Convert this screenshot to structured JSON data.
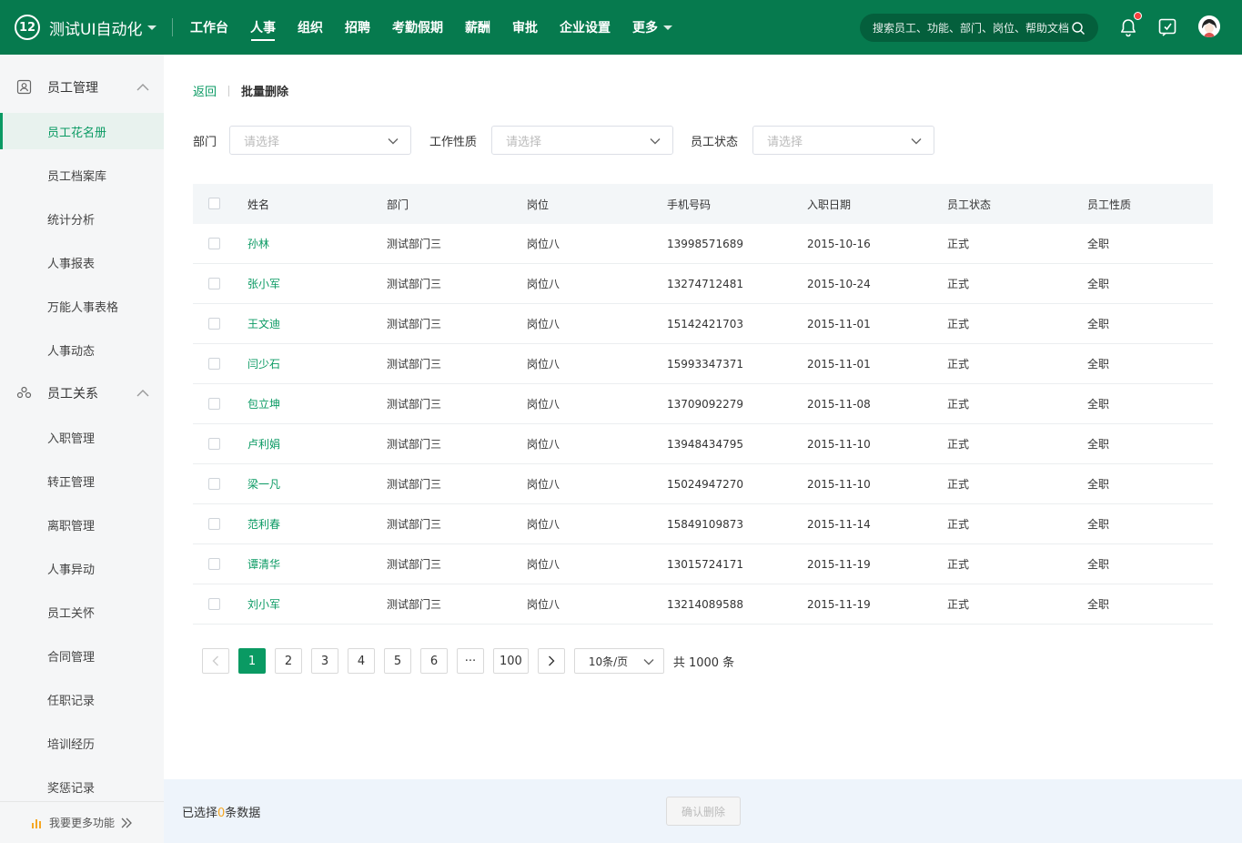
{
  "header": {
    "app_name": "测试UI自动化",
    "logo_text": "12",
    "nav": [
      "工作台",
      "人事",
      "组织",
      "招聘",
      "考勤假期",
      "薪酬",
      "审批",
      "企业设置",
      "更多"
    ],
    "active_nav": "人事",
    "search_placeholder": "搜索员工、功能、部门、岗位、帮助文档"
  },
  "sidebar": {
    "group1": "员工管理",
    "items1": [
      "员工花名册",
      "员工档案库",
      "统计分析",
      "人事报表",
      "万能人事表格",
      "人事动态"
    ],
    "active_item": "员工花名册",
    "group2": "员工关系",
    "items2": [
      "入职管理",
      "转正管理",
      "离职管理",
      "人事异动",
      "员工关怀",
      "合同管理",
      "任职记录",
      "培训经历",
      "奖惩记录"
    ],
    "more_features": "我要更多功能"
  },
  "breadcrumb": {
    "back": "返回",
    "current": "批量删除"
  },
  "filters": {
    "dept_label": "部门",
    "nature_label": "工作性质",
    "status_label": "员工状态",
    "placeholder": "请选择"
  },
  "table": {
    "columns": [
      "姓名",
      "部门",
      "岗位",
      "手机号码",
      "入职日期",
      "员工状态",
      "员工性质"
    ],
    "rows": [
      [
        "孙林",
        "测试部门三",
        "岗位八",
        "13998571689",
        "2015-10-16",
        "正式",
        "全职"
      ],
      [
        "张小军",
        "测试部门三",
        "岗位八",
        "13274712481",
        "2015-10-24",
        "正式",
        "全职"
      ],
      [
        "王文迪",
        "测试部门三",
        "岗位八",
        "15142421703",
        "2015-11-01",
        "正式",
        "全职"
      ],
      [
        "闫少石",
        "测试部门三",
        "岗位八",
        "15993347371",
        "2015-11-01",
        "正式",
        "全职"
      ],
      [
        "包立坤",
        "测试部门三",
        "岗位八",
        "13709092279",
        "2015-11-08",
        "正式",
        "全职"
      ],
      [
        "卢利娟",
        "测试部门三",
        "岗位八",
        "13948434795",
        "2015-11-10",
        "正式",
        "全职"
      ],
      [
        "梁一凡",
        "测试部门三",
        "岗位八",
        "15024947270",
        "2015-11-10",
        "正式",
        "全职"
      ],
      [
        "范利春",
        "测试部门三",
        "岗位八",
        "15849109873",
        "2015-11-14",
        "正式",
        "全职"
      ],
      [
        "谭清华",
        "测试部门三",
        "岗位八",
        "13015724171",
        "2015-11-19",
        "正式",
        "全职"
      ],
      [
        "刘小军",
        "测试部门三",
        "岗位八",
        "13214089588",
        "2015-11-19",
        "正式",
        "全职"
      ]
    ]
  },
  "pagination": {
    "pages": [
      "1",
      "2",
      "3",
      "4",
      "5",
      "6",
      "···",
      "100"
    ],
    "current": "1",
    "page_size": "10条/页",
    "total": "共 1000 条"
  },
  "footer": {
    "prefix": "已选择",
    "count": "0",
    "suffix": "条数据",
    "confirm": "确认删除"
  },
  "colors": {
    "primary": "#067a4e",
    "accent": "#0a9a63"
  }
}
